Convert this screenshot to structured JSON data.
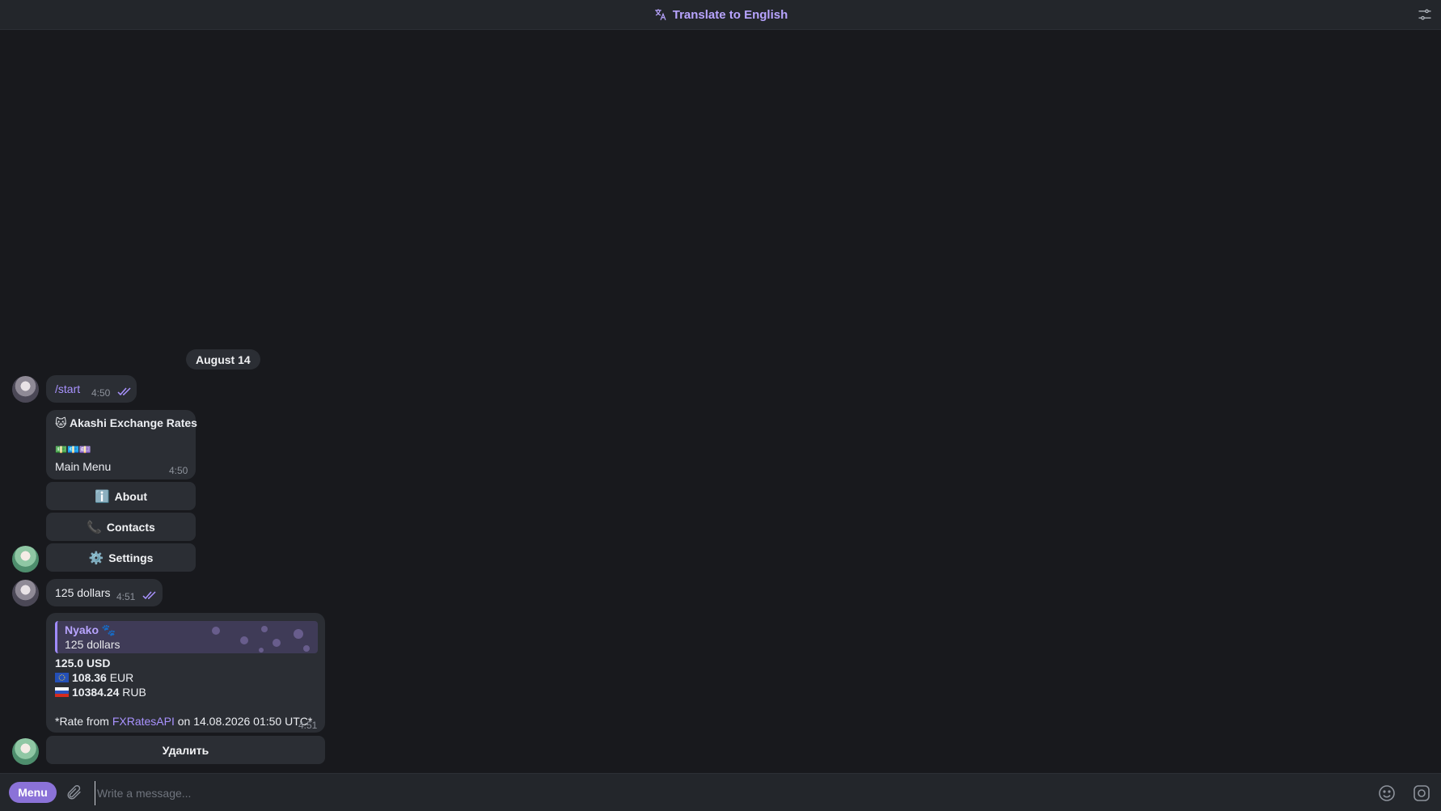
{
  "topbar": {
    "translate_label": "Translate to English"
  },
  "chat": {
    "date_separator": "August 14",
    "messages": [
      {
        "text": "/start",
        "time": "4:50"
      },
      {
        "title": "🐱 Akashi Exchange Rates",
        "emoji_row": "💵💶💷",
        "subtitle": "Main Menu",
        "time": "4:50",
        "buttons": [
          {
            "icon": "ℹ️",
            "label": "About"
          },
          {
            "icon": "📞",
            "label": "Contacts"
          },
          {
            "icon": "⚙️",
            "label": "Settings"
          }
        ]
      },
      {
        "text": "125 dollars",
        "time": "4:51"
      },
      {
        "reply_name": "Nyako 🐾",
        "reply_text": "125 dollars",
        "amount": "125.0 USD",
        "eur_value": "108.36",
        "eur_code": "EUR",
        "rub_value": "10384.24",
        "rub_code": "RUB",
        "rate_prefix": "*Rate from ",
        "rate_source": "FXRatesAPI",
        "rate_suffix": " on 14.08.2026 01:50 UTC*",
        "time": "4:51",
        "button_label": "Удалить"
      }
    ]
  },
  "composer": {
    "menu_label": "Menu",
    "placeholder": "Write a message..."
  },
  "colors": {
    "accent": "#a993ff",
    "background": "#18191d",
    "bubble": "#2b2e34",
    "menu_button": "#8b72d8"
  }
}
